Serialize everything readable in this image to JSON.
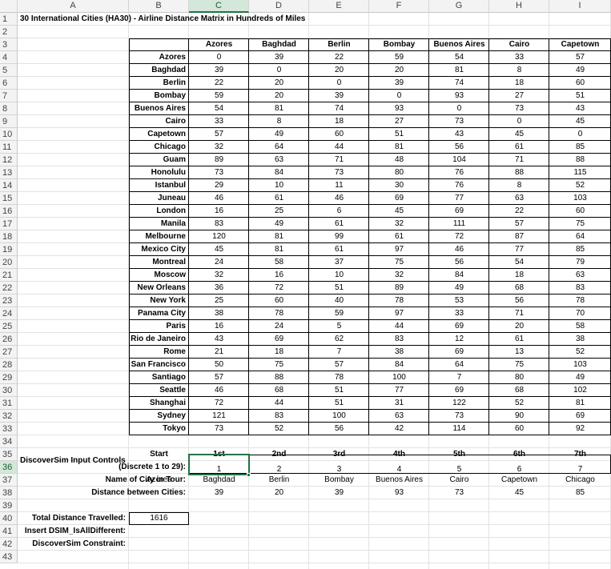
{
  "columns": [
    "A",
    "B",
    "C",
    "D",
    "E",
    "F",
    "G",
    "H",
    "I"
  ],
  "title": "30 International Cities (HA30) - Airline Distance Matrix in Hundreds of Miles",
  "matrix": {
    "col_headers": [
      "Azores",
      "Baghdad",
      "Berlin",
      "Bombay",
      "Buenos Aires",
      "Cairo",
      "Capetown"
    ],
    "rows": [
      {
        "city": "Azores",
        "values": [
          0,
          39,
          22,
          59,
          54,
          33,
          57
        ]
      },
      {
        "city": "Baghdad",
        "values": [
          39,
          0,
          20,
          20,
          81,
          8,
          49
        ]
      },
      {
        "city": "Berlin",
        "values": [
          22,
          20,
          0,
          39,
          74,
          18,
          60
        ]
      },
      {
        "city": "Bombay",
        "values": [
          59,
          20,
          39,
          0,
          93,
          27,
          51
        ]
      },
      {
        "city": "Buenos Aires",
        "values": [
          54,
          81,
          74,
          93,
          0,
          73,
          43
        ]
      },
      {
        "city": "Cairo",
        "values": [
          33,
          8,
          18,
          27,
          73,
          0,
          45
        ]
      },
      {
        "city": "Capetown",
        "values": [
          57,
          49,
          60,
          51,
          43,
          45,
          0
        ]
      },
      {
        "city": "Chicago",
        "values": [
          32,
          64,
          44,
          81,
          56,
          61,
          85
        ]
      },
      {
        "city": "Guam",
        "values": [
          89,
          63,
          71,
          48,
          104,
          71,
          88
        ]
      },
      {
        "city": "Honolulu",
        "values": [
          73,
          84,
          73,
          80,
          76,
          88,
          115
        ]
      },
      {
        "city": "Istanbul",
        "values": [
          29,
          10,
          11,
          30,
          76,
          8,
          52
        ]
      },
      {
        "city": "Juneau",
        "values": [
          46,
          61,
          46,
          69,
          77,
          63,
          103
        ]
      },
      {
        "city": "London",
        "values": [
          16,
          25,
          6,
          45,
          69,
          22,
          60
        ]
      },
      {
        "city": "Manila",
        "values": [
          83,
          49,
          61,
          32,
          111,
          57,
          75
        ]
      },
      {
        "city": "Melbourne",
        "values": [
          120,
          81,
          99,
          61,
          72,
          87,
          64
        ]
      },
      {
        "city": "Mexico City",
        "values": [
          45,
          81,
          61,
          97,
          46,
          77,
          85
        ]
      },
      {
        "city": "Montreal",
        "values": [
          24,
          58,
          37,
          75,
          56,
          54,
          79
        ]
      },
      {
        "city": "Moscow",
        "values": [
          32,
          16,
          10,
          32,
          84,
          18,
          63
        ]
      },
      {
        "city": "New Orleans",
        "values": [
          36,
          72,
          51,
          89,
          49,
          68,
          83
        ]
      },
      {
        "city": "New York",
        "values": [
          25,
          60,
          40,
          78,
          53,
          56,
          78
        ]
      },
      {
        "city": "Panama City",
        "values": [
          38,
          78,
          59,
          97,
          33,
          71,
          70
        ]
      },
      {
        "city": "Paris",
        "values": [
          16,
          24,
          5,
          44,
          69,
          20,
          58
        ]
      },
      {
        "city": "Rio de Janeiro",
        "values": [
          43,
          69,
          62,
          83,
          12,
          61,
          38
        ]
      },
      {
        "city": "Rome",
        "values": [
          21,
          18,
          7,
          38,
          69,
          13,
          52
        ]
      },
      {
        "city": "San Francisco",
        "values": [
          50,
          75,
          57,
          84,
          64,
          75,
          103
        ]
      },
      {
        "city": "Santiago",
        "values": [
          57,
          88,
          78,
          100,
          7,
          80,
          49
        ]
      },
      {
        "city": "Seattle",
        "values": [
          46,
          68,
          51,
          77,
          69,
          68,
          102
        ]
      },
      {
        "city": "Shanghai",
        "values": [
          72,
          44,
          51,
          31,
          122,
          52,
          81
        ]
      },
      {
        "city": "Sydney",
        "values": [
          121,
          83,
          100,
          63,
          73,
          90,
          69
        ]
      },
      {
        "city": "Tokyo",
        "values": [
          73,
          52,
          56,
          42,
          114,
          60,
          92
        ]
      }
    ]
  },
  "tour": {
    "start_label": "Start",
    "stops": [
      "1st",
      "2nd",
      "3rd",
      "4th",
      "5th",
      "6th",
      "7th"
    ],
    "input_label_line1": "DiscoverSim Input Controls",
    "input_label_line2": "(Discrete 1 to 29):",
    "inputs": [
      1,
      2,
      3,
      4,
      5,
      6,
      7
    ],
    "name_label": "Name of City in Tour:",
    "start_city": "Azores",
    "names": [
      "Baghdad",
      "Berlin",
      "Bombay",
      "Buenos Aires",
      "Cairo",
      "Capetown",
      "Chicago"
    ],
    "distance_label": "Distance between Cities:",
    "distances": [
      39,
      20,
      39,
      93,
      73,
      45,
      85
    ],
    "total_label": "Total Distance Travelled:",
    "total_value": 1616,
    "insert_label": "Insert DSIM_IsAllDifferent:",
    "constraint_label": "DiscoverSim Constraint:"
  }
}
